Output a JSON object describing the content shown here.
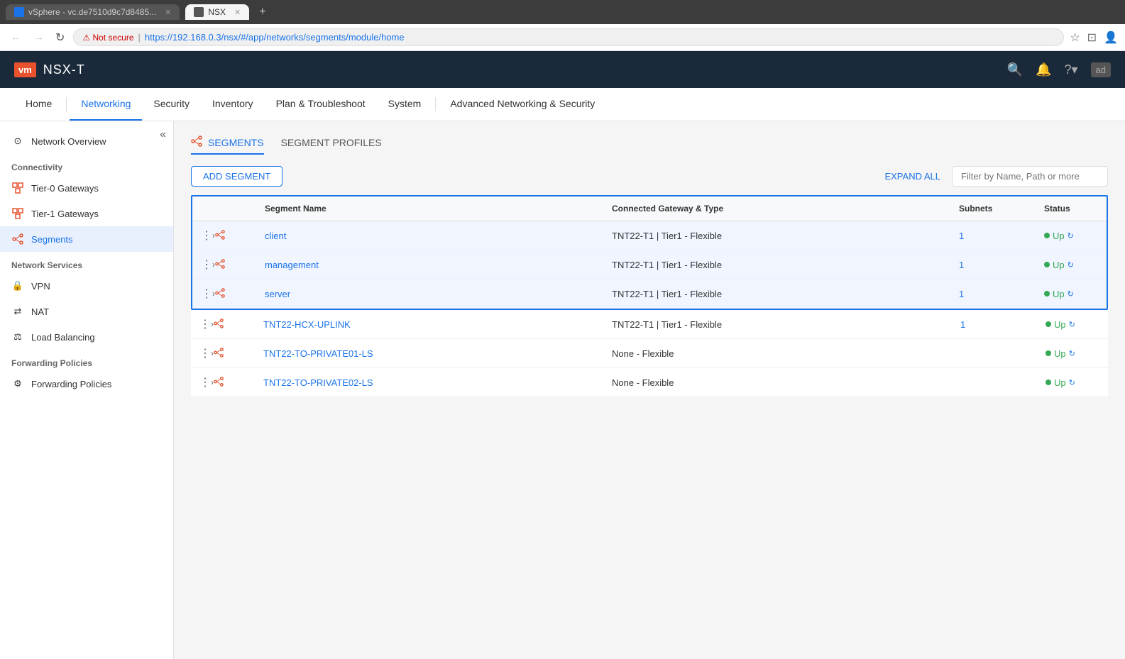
{
  "browser": {
    "tabs": [
      {
        "id": "vsphere",
        "label": "vSphere - vc.de7510d9c7d8485...",
        "active": false,
        "icon_color": "#1a73e8"
      },
      {
        "id": "nsx",
        "label": "NSX",
        "active": true,
        "icon_color": "#666"
      }
    ],
    "new_tab_label": "+",
    "nav": {
      "back_disabled": true,
      "forward_disabled": true,
      "refresh_label": "↻"
    },
    "address": {
      "not_secure_label": "⚠ Not secure",
      "separator": "|",
      "url": "https://192.168.0.3/nsx/#/app/networks/segments/module/home"
    },
    "addr_icons": [
      "★",
      "⋮"
    ]
  },
  "app": {
    "logo": "vm",
    "name": "NSX-T",
    "header_icons": [
      "🔍",
      "🔔",
      "?",
      "ad"
    ]
  },
  "nav_items": [
    {
      "id": "home",
      "label": "Home",
      "active": false
    },
    {
      "id": "networking",
      "label": "Networking",
      "active": true
    },
    {
      "id": "security",
      "label": "Security",
      "active": false
    },
    {
      "id": "inventory",
      "label": "Inventory",
      "active": false
    },
    {
      "id": "plan",
      "label": "Plan & Troubleshoot",
      "active": false
    },
    {
      "id": "system",
      "label": "System",
      "active": false
    },
    {
      "id": "advanced",
      "label": "Advanced Networking & Security",
      "active": false
    }
  ],
  "sidebar": {
    "collapse_icon": "«",
    "items_top": [
      {
        "id": "network-overview",
        "label": "Network Overview",
        "icon": "⊙"
      }
    ],
    "sections": [
      {
        "label": "Connectivity",
        "items": [
          {
            "id": "tier0-gateways",
            "label": "Tier-0 Gateways",
            "icon": "▦"
          },
          {
            "id": "tier1-gateways",
            "label": "Tier-1 Gateways",
            "icon": "▦"
          },
          {
            "id": "segments",
            "label": "Segments",
            "icon": "📡",
            "active": true
          }
        ]
      },
      {
        "label": "Network Services",
        "items": [
          {
            "id": "vpn",
            "label": "VPN",
            "icon": "🔒"
          },
          {
            "id": "nat",
            "label": "NAT",
            "icon": "⇄"
          },
          {
            "id": "load-balancing",
            "label": "Load Balancing",
            "icon": "⚖"
          }
        ]
      },
      {
        "label": "Forwarding Policies",
        "items": [
          {
            "id": "forwarding-policies",
            "label": "Forwarding Policies",
            "icon": "⚙"
          }
        ]
      }
    ]
  },
  "content": {
    "tabs": [
      {
        "id": "segments",
        "label": "SEGMENTS",
        "active": true
      },
      {
        "id": "segment-profiles",
        "label": "SEGMENT PROFILES",
        "active": false
      }
    ],
    "toolbar": {
      "add_segment_label": "ADD SEGMENT",
      "expand_all_label": "EXPAND ALL",
      "filter_placeholder": "Filter by Name, Path or more"
    },
    "table": {
      "columns": [
        {
          "id": "actions",
          "label": ""
        },
        {
          "id": "name",
          "label": "Segment Name"
        },
        {
          "id": "gateway",
          "label": "Connected Gateway & Type"
        },
        {
          "id": "subnets",
          "label": "Subnets"
        },
        {
          "id": "status",
          "label": "Status"
        }
      ],
      "highlighted_rows": [
        {
          "id": "client",
          "name": "client",
          "gateway": "TNT22-T1 | Tier1 - Flexible",
          "subnets": "1",
          "status": "Up",
          "status_color": "#34a853"
        },
        {
          "id": "management",
          "name": "management",
          "gateway": "TNT22-T1 | Tier1 - Flexible",
          "subnets": "1",
          "status": "Up",
          "status_color": "#34a853"
        },
        {
          "id": "server",
          "name": "server",
          "gateway": "TNT22-T1 | Tier1 - Flexible",
          "subnets": "1",
          "status": "Up",
          "status_color": "#34a853"
        }
      ],
      "other_rows": [
        {
          "id": "tnt22-hcx-uplink",
          "name": "TNT22-HCX-UPLINK",
          "gateway": "TNT22-T1 | Tier1 - Flexible",
          "subnets": "1",
          "status": "Up",
          "status_color": "#34a853"
        },
        {
          "id": "tnt22-to-private01",
          "name": "TNT22-TO-PRIVATE01-LS",
          "gateway": "None - Flexible",
          "subnets": "",
          "status": "Up",
          "status_color": "#34a853"
        },
        {
          "id": "tnt22-to-private02",
          "name": "TNT22-TO-PRIVATE02-LS",
          "gateway": "None - Flexible",
          "subnets": "",
          "status": "Up",
          "status_color": "#34a853"
        }
      ]
    }
  }
}
